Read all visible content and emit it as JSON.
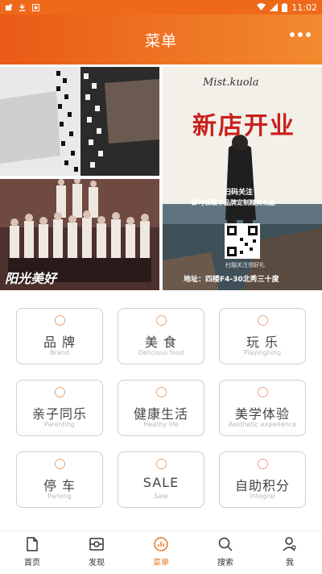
{
  "status_bar": {
    "time": "11:02"
  },
  "header": {
    "title": "菜单"
  },
  "banners": {
    "left_bottom_caption": "阳光美好",
    "right": {
      "brand": "Mist.kuola",
      "headline": "新店开业",
      "line1": "扫码关注",
      "line2": "即可领取本品牌定制精美礼品",
      "qr_note": "扫描关注领好礼",
      "address": "地址：四楼F4-30北秀三十度"
    }
  },
  "menu": [
    {
      "cn": "品 牌",
      "en": "Brand"
    },
    {
      "cn": "美 食",
      "en": "Delicious food"
    },
    {
      "cn": "玩 乐",
      "en": "Playinghing"
    },
    {
      "cn": "亲子同乐",
      "en": "Parenting"
    },
    {
      "cn": "健康生活",
      "en": "Heathy life"
    },
    {
      "cn": "美学体验",
      "en": "Aesthetic experience"
    },
    {
      "cn": "停 车",
      "en": "Parking"
    },
    {
      "cn": "SALE",
      "en": "Sale"
    },
    {
      "cn": "自助积分",
      "en": "Integral"
    }
  ],
  "tabbar": [
    {
      "label": "首页"
    },
    {
      "label": "发现"
    },
    {
      "label": "菜单"
    },
    {
      "label": "搜索"
    },
    {
      "label": "我"
    }
  ],
  "colors": {
    "accent": "#e8761f",
    "header_start": "#e95a16",
    "header_end": "#f28a2e"
  }
}
